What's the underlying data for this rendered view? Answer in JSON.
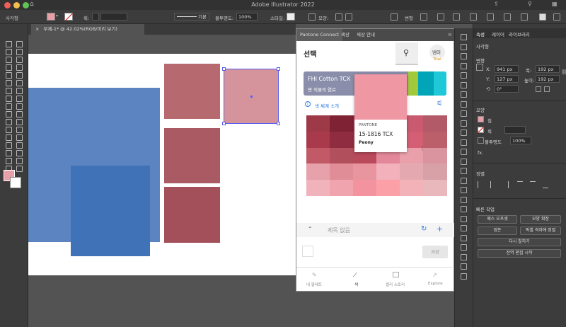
{
  "app": {
    "title": "Adobe Illustrator 2022"
  },
  "control_bar": {
    "layer_label": "사각형",
    "stroke_label": "획:",
    "stroke_style": "기본",
    "opacity_label": "불투명도:",
    "opacity_value": "100%",
    "style_label": "스타일:",
    "shape_label": "모양:",
    "transform_label": "변형"
  },
  "document": {
    "tab_title": "무제-1* @ 42.02%(RGB/미리 보기)",
    "close": "×"
  },
  "pantone": {
    "tabs": [
      "Pantone Connect",
      "색상",
      "색상 안내"
    ],
    "title": "선택",
    "avatar_name": "냄미",
    "avatar_badge": "Trial",
    "book_name": "FHI Cotton TCX",
    "book_sub": "면 직물의 염료",
    "intro_link": "색 체계 소개",
    "card": {
      "brand": "PANTONE",
      "code": "15-1816 TCX",
      "name": "Peony",
      "color": "#ef98a4"
    },
    "palette_placeholder": "제목 없음",
    "save_label": "저장",
    "nav": [
      "내 팔레트",
      "색",
      "컬러 스토리",
      "Explore"
    ]
  },
  "properties": {
    "tabs": [
      "속성",
      "레이어",
      "라이브러리"
    ],
    "section_shape": "사각형",
    "section_transform": "변형",
    "x_label": "X:",
    "x_value": "941 px",
    "y_label": "Y:",
    "y_value": "127 px",
    "w_label": "폭:",
    "w_value": "192 px",
    "h_label": "높이:",
    "h_value": "192 px",
    "angle_value": "0°",
    "section_appearance": "모양",
    "fill_label": "칠",
    "stroke_label": "획",
    "opacity_label": "불투명도",
    "opacity_value": "100%",
    "fx_label": "fx.",
    "section_align": "정렬",
    "section_quick": "빠른 작업",
    "btn_offset": "패스 오프셋",
    "btn_expand": "모양 확장",
    "btn_arrange": "정돈",
    "btn_pixel": "픽셀 격자에 정렬",
    "btn_recolor": "다시 칠하기",
    "btn_global": "전역 편집 시작"
  },
  "colors": {
    "fill": "#e7a0a8",
    "rect_pink": "#d5939b",
    "rect_rose": "#b76970",
    "rect_dusty": "#a95a62",
    "rect_wine": "#a4505b",
    "blue_light": "#5b84c0",
    "blue_dark": "#3f72b6"
  }
}
